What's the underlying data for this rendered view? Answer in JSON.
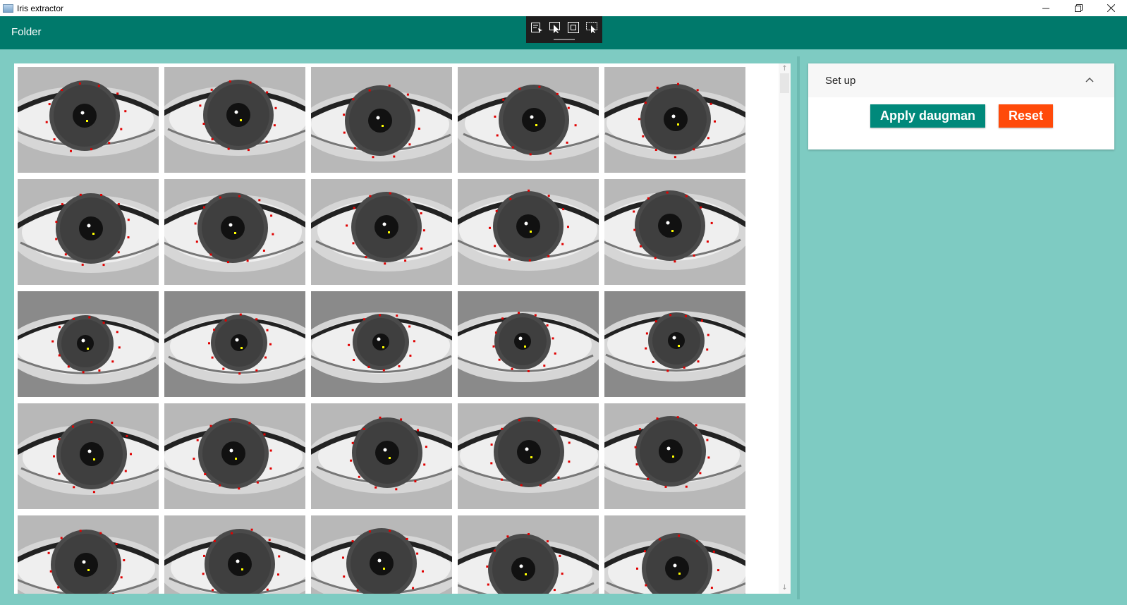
{
  "window": {
    "title": "Iris extractor",
    "controls": [
      "minimize-icon",
      "restore-icon",
      "close-icon"
    ]
  },
  "appbar": {
    "menu_label": "Folder",
    "color": "#00796b",
    "floating_toolbar": [
      "select-tool-icon",
      "pointer-tool-icon",
      "rectangle-tool-icon",
      "region-tool-icon"
    ]
  },
  "gallery": {
    "columns": 5,
    "visible_rows": 5,
    "thumbnail_count": 25,
    "content": "grayscale eye images with red landmark dots and yellow center dot"
  },
  "setup": {
    "title": "Set up",
    "apply_label": "Apply daugman",
    "reset_label": "Reset",
    "apply_color": "#00897b",
    "reset_color": "#ff4a0a"
  },
  "theme": {
    "background": "#7ecbc2"
  }
}
